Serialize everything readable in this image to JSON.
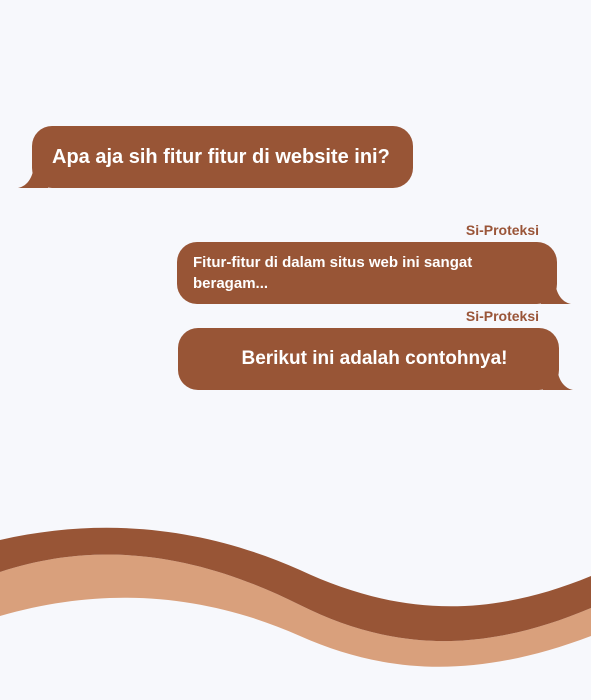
{
  "colors": {
    "background": "#f7f8fc",
    "bubble": "#985536",
    "bubble_text": "#ffffff",
    "sender_name": "#9a5538",
    "wave_dark": "#985536",
    "wave_light": "#d9a07c"
  },
  "chat": {
    "messages": [
      {
        "side": "left",
        "sender": "",
        "text": "Apa aja sih fitur fitur di website ini?"
      },
      {
        "side": "right",
        "sender": "Si-Proteksi",
        "text": "Fitur-fitur di dalam situs web ini sangat beragam..."
      },
      {
        "side": "right",
        "sender": "Si-Proteksi",
        "text": "Berikut ini adalah contohnya!"
      }
    ]
  }
}
